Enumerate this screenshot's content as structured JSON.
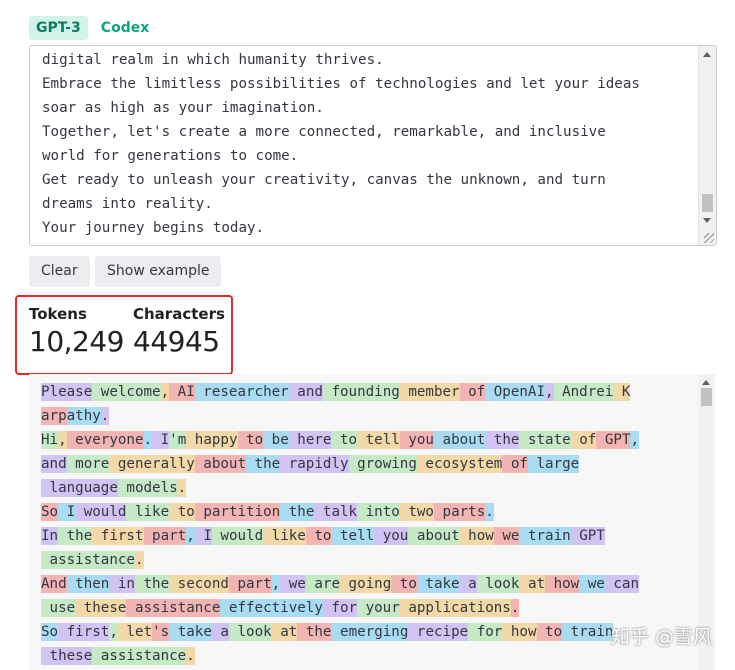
{
  "tabs": [
    {
      "label": "GPT-3",
      "active": true
    },
    {
      "label": "Codex",
      "active": false
    }
  ],
  "input_text": "digital realm in which humanity thrives.\nEmbrace the limitless possibilities of technologies and let your ideas\nsoar as high as your imagination.\nTogether, let's create a more connected, remarkable, and inclusive\nworld for generations to come.\nGet ready to unleash your creativity, canvas the unknown, and turn\ndreams into reality.\nYour journey begins today.",
  "buttons": {
    "clear": "Clear",
    "show_example": "Show example"
  },
  "stats": {
    "tokens_label": "Tokens",
    "tokens_value": "10,249",
    "characters_label": "Characters",
    "characters_value": "44945"
  },
  "colors": {
    "accent": "#10a37f",
    "highlight_border": "#e12b2b",
    "token_palette": [
      "#d2c3f5",
      "#c5eac5",
      "#f4d9a8",
      "#f3b4b4",
      "#a9dcf2"
    ]
  },
  "token_lines": [
    [
      "Please",
      " welcome",
      ",",
      " AI",
      " researcher",
      " and",
      " founding",
      " member",
      " of",
      " OpenAI",
      ",",
      " Andrei",
      " K"
    ],
    [
      "arp",
      "athy",
      "."
    ],
    [
      "Hi",
      ",",
      " everyone",
      ".",
      " I",
      "'m",
      " happy",
      " to",
      " be",
      " here",
      " to",
      " tell",
      " you",
      " about",
      " the",
      " state",
      " of",
      " GPT",
      ","
    ],
    [
      "and",
      " more",
      " generally",
      " about",
      " the",
      " rapidly",
      " growing",
      " ecosystem",
      " of",
      " large"
    ],
    [
      " language",
      " models",
      "."
    ],
    [
      "So",
      " I",
      " would",
      " like",
      " to",
      " partition",
      " the",
      " talk",
      " into",
      " two",
      " parts",
      "."
    ],
    [
      "In",
      " the",
      " first",
      " part",
      ",",
      " I",
      " would",
      " like",
      " to",
      " tell",
      " you",
      " about",
      " how",
      " we",
      " train",
      " GPT"
    ],
    [
      " assistance",
      "."
    ],
    [
      "And",
      " then",
      " in",
      " the",
      " second",
      " part",
      ",",
      " we",
      " are",
      " going",
      " to",
      " take",
      " a",
      " look",
      " at",
      " how",
      " we",
      " can"
    ],
    [
      " use",
      " these",
      " assistance",
      " effectively",
      " for",
      " your",
      " applications",
      "."
    ],
    [
      "So",
      " first",
      ",",
      " let",
      "'s",
      " take",
      " a",
      " look",
      " at",
      " the",
      " emerging",
      " recipe",
      " for",
      " how",
      " to",
      " train"
    ],
    [
      " these",
      " assistance",
      "."
    ]
  ],
  "watermark": "知乎 @雪风"
}
